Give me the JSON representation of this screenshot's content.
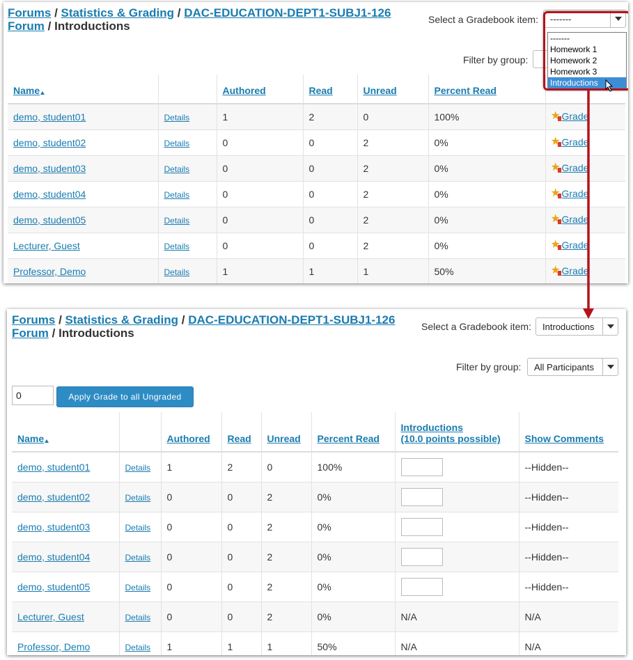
{
  "breadcrumb": {
    "forums": "Forums",
    "sep": "/",
    "statistics": "Statistics & Grading",
    "site": "DAC-EDUCATION-DEPT1-SUBJ1-126",
    "forum": "Forum",
    "current": "Introductions"
  },
  "gradebook_label": "Select a Gradebook item:",
  "filter_label": "Filter by group:",
  "top": {
    "select_value": "-------",
    "dropdown_options": [
      "-------",
      "Homework 1",
      "Homework 2",
      "Homework 3",
      "Introductions"
    ],
    "selected_option": "Introductions",
    "headers": {
      "name": "Name",
      "authored": "Authored",
      "read": "Read",
      "unread": "Unread",
      "percent": "Percent Read"
    },
    "grade_label": " Grade",
    "rows": [
      {
        "name": "demo, student01",
        "details": "Details",
        "authored": "1",
        "read": "2",
        "unread": "0",
        "percent": "100%"
      },
      {
        "name": "demo, student02",
        "details": "Details",
        "authored": "0",
        "read": "0",
        "unread": "2",
        "percent": "0%"
      },
      {
        "name": "demo, student03",
        "details": "Details",
        "authored": "0",
        "read": "0",
        "unread": "2",
        "percent": "0%"
      },
      {
        "name": "demo, student04",
        "details": "Details",
        "authored": "0",
        "read": "0",
        "unread": "2",
        "percent": "0%"
      },
      {
        "name": "demo, student05",
        "details": "Details",
        "authored": "0",
        "read": "0",
        "unread": "2",
        "percent": "0%"
      },
      {
        "name": "Lecturer, Guest",
        "details": "Details",
        "authored": "0",
        "read": "0",
        "unread": "2",
        "percent": "0%"
      },
      {
        "name": "Professor, Demo",
        "details": "Details",
        "authored": "1",
        "read": "1",
        "unread": "1",
        "percent": "50%"
      }
    ]
  },
  "bottom": {
    "select_value": "Introductions",
    "filter_value": "All Participants",
    "grade_all_value": "0",
    "apply_button": "Apply Grade to all Ungraded",
    "headers": {
      "name": "Name",
      "authored": "Authored",
      "read": "Read",
      "unread": "Unread",
      "percent": "Percent Read",
      "item_line1": "Introductions",
      "item_line2": "(10.0 points possible)",
      "comments": "Show Comments"
    },
    "rows": [
      {
        "name": "demo, student01",
        "details": "Details",
        "authored": "1",
        "read": "2",
        "unread": "0",
        "percent": "100%",
        "grade": "",
        "comment": "--Hidden--"
      },
      {
        "name": "demo, student02",
        "details": "Details",
        "authored": "0",
        "read": "0",
        "unread": "2",
        "percent": "0%",
        "grade": "",
        "comment": "--Hidden--"
      },
      {
        "name": "demo, student03",
        "details": "Details",
        "authored": "0",
        "read": "0",
        "unread": "2",
        "percent": "0%",
        "grade": "",
        "comment": "--Hidden--"
      },
      {
        "name": "demo, student04",
        "details": "Details",
        "authored": "0",
        "read": "0",
        "unread": "2",
        "percent": "0%",
        "grade": "",
        "comment": "--Hidden--"
      },
      {
        "name": "demo, student05",
        "details": "Details",
        "authored": "0",
        "read": "0",
        "unread": "2",
        "percent": "0%",
        "grade": "",
        "comment": "--Hidden--"
      },
      {
        "name": "Lecturer, Guest",
        "details": "Details",
        "authored": "0",
        "read": "0",
        "unread": "2",
        "percent": "0%",
        "grade": "N/A",
        "comment": "N/A"
      },
      {
        "name": "Professor, Demo",
        "details": "Details",
        "authored": "1",
        "read": "1",
        "unread": "1",
        "percent": "50%",
        "grade": "N/A",
        "comment": "N/A"
      }
    ]
  },
  "colors": {
    "link": "#1a7cb0",
    "annotation": "#b5121b",
    "button": "#2e8cc4",
    "option_highlight": "#3e8ed6"
  }
}
